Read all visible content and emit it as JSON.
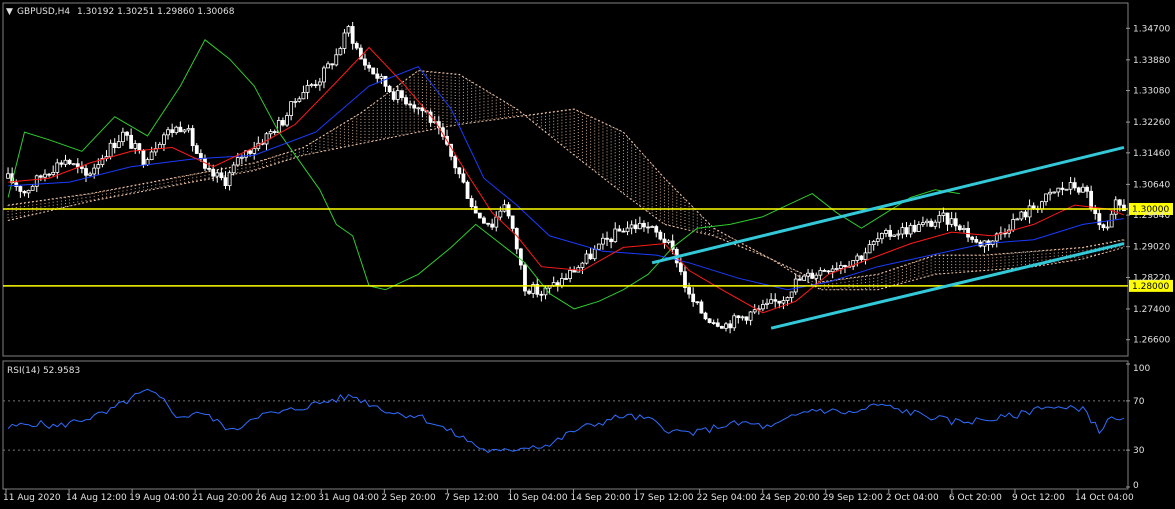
{
  "header": {
    "symbol": "GBPUSD,H4",
    "ohlc": "1.30192 1.30251 1.29860 1.30068"
  },
  "rsi_header": "RSI(14) 52.9583",
  "colors": {
    "bull": "#ffffff",
    "bear": "#ffffff",
    "tenkan": "#ff1a1a",
    "kijun": "#1a3cff",
    "chikou": "#2ecc2e",
    "cloud": "#f2c7a8",
    "level": "#ffff00",
    "channel": "#33c9d9",
    "rsi": "#2f6cff",
    "grid": "#3a3a3a",
    "axis": "#9a9a9a"
  },
  "chart_data": [
    {
      "type": "candlestick",
      "title": "GBPUSD,H4",
      "ylim": [
        1.2628,
        1.3528
      ],
      "y_ticks": [
        "1.34700",
        "1.33880",
        "1.33080",
        "1.32260",
        "1.31460",
        "1.30640",
        "1.29840",
        "1.29020",
        "1.28220",
        "1.27400",
        "1.26600"
      ],
      "x_ticks": [
        "11 Aug 2020",
        "14 Aug 12:00",
        "19 Aug 04:00",
        "21 Aug 20:00",
        "26 Aug 12:00",
        "31 Aug 04:00",
        "2 Sep 20:00",
        "7 Sep 12:00",
        "10 Sep 04:00",
        "14 Sep 20:00",
        "17 Sep 12:00",
        "22 Sep 04:00",
        "24 Sep 20:00",
        "29 Sep 12:00",
        "2 Oct 04:00",
        "6 Oct 20:00",
        "9 Oct 12:00",
        "14 Oct 04:00"
      ],
      "price_path": [
        [
          0,
          1.308
        ],
        [
          4,
          1.3045
        ],
        [
          9,
          1.3095
        ],
        [
          14,
          1.313
        ],
        [
          19,
          1.3085
        ],
        [
          24,
          1.315
        ],
        [
          28,
          1.3195
        ],
        [
          33,
          1.313
        ],
        [
          38,
          1.3195
        ],
        [
          43,
          1.322
        ],
        [
          48,
          1.3095
        ],
        [
          53,
          1.3075
        ],
        [
          57,
          1.314
        ],
        [
          62,
          1.318
        ],
        [
          67,
          1.323
        ],
        [
          71,
          1.33
        ],
        [
          76,
          1.334
        ],
        [
          80,
          1.34
        ],
        [
          83,
          1.347
        ],
        [
          86,
          1.339
        ],
        [
          90,
          1.3345
        ],
        [
          94,
          1.33
        ],
        [
          98,
          1.328
        ],
        [
          102,
          1.325
        ],
        [
          106,
          1.318
        ],
        [
          110,
          1.309
        ],
        [
          114,
          1.299
        ],
        [
          118,
          1.296
        ],
        [
          121,
          1.302
        ],
        [
          124,
          1.29
        ],
        [
          126,
          1.28
        ],
        [
          130,
          1.278
        ],
        [
          135,
          1.2815
        ],
        [
          140,
          1.286
        ],
        [
          145,
          1.291
        ],
        [
          150,
          1.295
        ],
        [
          155,
          1.296
        ],
        [
          160,
          1.292
        ],
        [
          163,
          1.287
        ],
        [
          166,
          1.277
        ],
        [
          170,
          1.272
        ],
        [
          175,
          1.27
        ],
        [
          180,
          1.2725
        ],
        [
          185,
          1.2745
        ],
        [
          189,
          1.277
        ],
        [
          192,
          1.281
        ],
        [
          196,
          1.283
        ],
        [
          200,
          1.285
        ],
        [
          204,
          1.286
        ],
        [
          208,
          1.288
        ],
        [
          212,
          1.292
        ],
        [
          216,
          1.294
        ],
        [
          220,
          1.295
        ],
        [
          224,
          1.296
        ],
        [
          228,
          1.2975
        ],
        [
          232,
          1.296
        ],
        [
          236,
          1.291
        ],
        [
          240,
          1.292
        ],
        [
          244,
          1.296
        ],
        [
          248,
          1.299
        ],
        [
          252,
          1.302
        ],
        [
          256,
          1.305
        ],
        [
          260,
          1.306
        ],
        [
          263,
          1.304
        ],
        [
          266,
          1.295
        ],
        [
          268,
          1.294
        ],
        [
          270,
          1.301
        ],
        [
          272,
          1.3005
        ]
      ],
      "bars_total": 273,
      "indicators": {
        "tenkan": [
          [
            0,
            1.307
          ],
          [
            10,
            1.308
          ],
          [
            20,
            1.312
          ],
          [
            30,
            1.315
          ],
          [
            40,
            1.316
          ],
          [
            50,
            1.311
          ],
          [
            60,
            1.316
          ],
          [
            70,
            1.322
          ],
          [
            80,
            1.333
          ],
          [
            88,
            1.342
          ],
          [
            96,
            1.333
          ],
          [
            104,
            1.323
          ],
          [
            112,
            1.309
          ],
          [
            118,
            1.299
          ],
          [
            124,
            1.293
          ],
          [
            130,
            1.285
          ],
          [
            140,
            1.284
          ],
          [
            150,
            1.29
          ],
          [
            160,
            1.291
          ],
          [
            166,
            1.284
          ],
          [
            174,
            1.279
          ],
          [
            184,
            1.273
          ],
          [
            192,
            1.276
          ],
          [
            200,
            1.283
          ],
          [
            210,
            1.287
          ],
          [
            220,
            1.291
          ],
          [
            230,
            1.294
          ],
          [
            240,
            1.293
          ],
          [
            250,
            1.296
          ],
          [
            260,
            1.301
          ],
          [
            268,
            1.3
          ],
          [
            272,
            1.2985
          ]
        ],
        "kijun": [
          [
            0,
            1.306
          ],
          [
            15,
            1.307
          ],
          [
            30,
            1.311
          ],
          [
            45,
            1.313
          ],
          [
            60,
            1.314
          ],
          [
            75,
            1.32
          ],
          [
            88,
            1.332
          ],
          [
            100,
            1.337
          ],
          [
            108,
            1.326
          ],
          [
            116,
            1.308
          ],
          [
            124,
            1.301
          ],
          [
            132,
            1.293
          ],
          [
            145,
            1.289
          ],
          [
            158,
            1.288
          ],
          [
            166,
            1.286
          ],
          [
            178,
            1.282
          ],
          [
            190,
            1.279
          ],
          [
            200,
            1.281
          ],
          [
            212,
            1.285
          ],
          [
            225,
            1.288
          ],
          [
            238,
            1.291
          ],
          [
            250,
            1.292
          ],
          [
            262,
            1.296
          ],
          [
            272,
            1.2975
          ]
        ],
        "chikou": [
          [
            0,
            1.303
          ],
          [
            4,
            1.32
          ],
          [
            10,
            1.318
          ],
          [
            18,
            1.315
          ],
          [
            26,
            1.324
          ],
          [
            34,
            1.319
          ],
          [
            42,
            1.332
          ],
          [
            48,
            1.344
          ],
          [
            54,
            1.339
          ],
          [
            60,
            1.332
          ],
          [
            66,
            1.32
          ],
          [
            72,
            1.311
          ],
          [
            76,
            1.305
          ],
          [
            80,
            1.296
          ],
          [
            84,
            1.293
          ],
          [
            88,
            1.28
          ],
          [
            92,
            1.279
          ],
          [
            100,
            1.283
          ],
          [
            108,
            1.29
          ],
          [
            114,
            1.296
          ],
          [
            120,
            1.291
          ],
          [
            126,
            1.286
          ],
          [
            132,
            1.278
          ],
          [
            138,
            1.274
          ],
          [
            144,
            1.276
          ],
          [
            150,
            1.279
          ],
          [
            156,
            1.283
          ],
          [
            162,
            1.29
          ],
          [
            168,
            1.295
          ],
          [
            176,
            1.296
          ],
          [
            184,
            1.298
          ],
          [
            190,
            1.301
          ],
          [
            196,
            1.304
          ],
          [
            202,
            1.299
          ],
          [
            208,
            1.295
          ],
          [
            214,
            1.299
          ],
          [
            220,
            1.303
          ],
          [
            226,
            1.305
          ],
          [
            232,
            1.304
          ]
        ],
        "cloud_a": [
          [
            0,
            1.301
          ],
          [
            20,
            1.304
          ],
          [
            40,
            1.308
          ],
          [
            60,
            1.312
          ],
          [
            72,
            1.316
          ],
          [
            86,
            1.325
          ],
          [
            100,
            1.336
          ],
          [
            110,
            1.335
          ],
          [
            124,
            1.326
          ],
          [
            138,
            1.314
          ],
          [
            150,
            1.304
          ],
          [
            160,
            1.296
          ],
          [
            172,
            1.293
          ],
          [
            186,
            1.287
          ],
          [
            198,
            1.281
          ],
          [
            212,
            1.283
          ],
          [
            226,
            1.288
          ],
          [
            238,
            1.288
          ],
          [
            250,
            1.289
          ],
          [
            262,
            1.29
          ],
          [
            272,
            1.292
          ]
        ],
        "cloud_b": [
          [
            0,
            1.297
          ],
          [
            20,
            1.302
          ],
          [
            40,
            1.306
          ],
          [
            60,
            1.31
          ],
          [
            72,
            1.314
          ],
          [
            86,
            1.317
          ],
          [
            100,
            1.32
          ],
          [
            110,
            1.322
          ],
          [
            124,
            1.324
          ],
          [
            138,
            1.326
          ],
          [
            150,
            1.32
          ],
          [
            160,
            1.308
          ],
          [
            172,
            1.295
          ],
          [
            186,
            1.287
          ],
          [
            198,
            1.279
          ],
          [
            212,
            1.279
          ],
          [
            226,
            1.283
          ],
          [
            238,
            1.284
          ],
          [
            250,
            1.285
          ],
          [
            262,
            1.287
          ],
          [
            272,
            1.29
          ]
        ]
      },
      "levels": [
        {
          "price": 1.3,
          "label": "1.30000"
        },
        {
          "price": 1.28,
          "label": "1.28000"
        }
      ],
      "channel": {
        "upper": [
          [
            157,
            1.286
          ],
          [
            272,
            1.316
          ]
        ],
        "lower": [
          [
            186,
            1.269
          ],
          [
            272,
            1.291
          ]
        ]
      }
    },
    {
      "type": "line",
      "title": "RSI(14) 52.9583",
      "ylim": [
        0,
        100
      ],
      "y_ticks": [
        "100",
        "70",
        "30",
        "0"
      ],
      "series": [
        {
          "values": [
            [
              0,
              48
            ],
            [
              6,
              52
            ],
            [
              12,
              49
            ],
            [
              18,
              55
            ],
            [
              24,
              60
            ],
            [
              30,
              72
            ],
            [
              34,
              78
            ],
            [
              38,
              70
            ],
            [
              42,
              55
            ],
            [
              46,
              62
            ],
            [
              50,
              55
            ],
            [
              55,
              45
            ],
            [
              60,
              58
            ],
            [
              66,
              60
            ],
            [
              72,
              65
            ],
            [
              78,
              70
            ],
            [
              84,
              74
            ],
            [
              88,
              68
            ],
            [
              94,
              60
            ],
            [
              100,
              58
            ],
            [
              106,
              48
            ],
            [
              112,
              38
            ],
            [
              116,
              30
            ],
            [
              120,
              28
            ],
            [
              126,
              33
            ],
            [
              132,
              34
            ],
            [
              138,
              46
            ],
            [
              144,
              52
            ],
            [
              150,
              58
            ],
            [
              156,
              55
            ],
            [
              162,
              45
            ],
            [
              168,
              44
            ],
            [
              174,
              50
            ],
            [
              180,
              52
            ],
            [
              186,
              48
            ],
            [
              192,
              58
            ],
            [
              196,
              63
            ],
            [
              200,
              62
            ],
            [
              206,
              60
            ],
            [
              212,
              67
            ],
            [
              218,
              62
            ],
            [
              224,
              58
            ],
            [
              230,
              53
            ],
            [
              236,
              54
            ],
            [
              242,
              56
            ],
            [
              248,
              60
            ],
            [
              252,
              66
            ],
            [
              258,
              63
            ],
            [
              262,
              65
            ],
            [
              266,
              45
            ],
            [
              268,
              55
            ],
            [
              272,
              53
            ]
          ]
        }
      ]
    }
  ]
}
